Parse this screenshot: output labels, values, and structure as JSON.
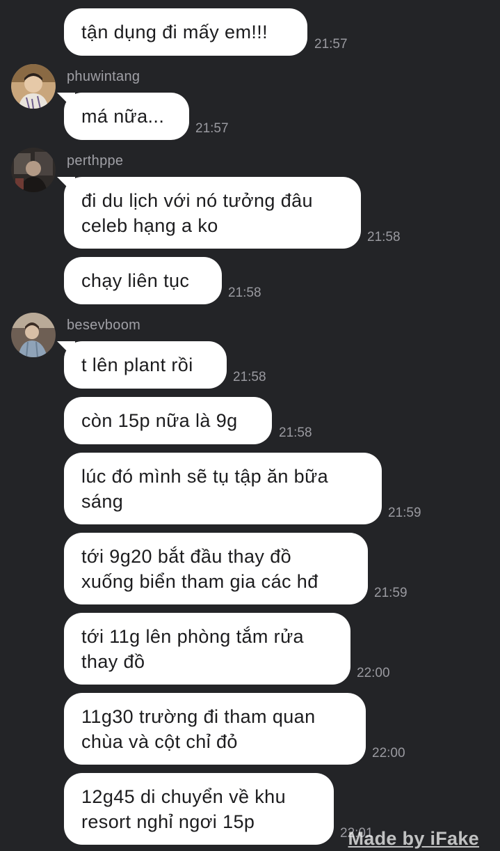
{
  "chat": {
    "messages": [
      {
        "text": "tận dụng đi mấy em!!!",
        "time": "21:57"
      },
      {
        "sender": "phuwintang",
        "text": "má nữa...",
        "time": "21:57"
      },
      {
        "sender": "perthppe",
        "text": "đi du lịch với nó tưởng đâu\nceleb hạng a ko",
        "time": "21:58"
      },
      {
        "text": "chạy liên tục",
        "time": "21:58"
      },
      {
        "sender": "besevboom",
        "text": "t lên plant rồi",
        "time": "21:58"
      },
      {
        "text": "còn 15p nữa là 9g",
        "time": "21:58"
      },
      {
        "text": "lúc đó mình sẽ tụ tập ăn bữa\nsáng",
        "time": "21:59"
      },
      {
        "text": "tới 9g20 bắt đầu thay đồ\nxuống biển tham gia các hđ",
        "time": "21:59"
      },
      {
        "text": "tới 11g lên phòng tắm rửa\nthay đồ",
        "time": "22:00"
      },
      {
        "text": "11g30 trường đi tham quan\nchùa và cột chỉ đỏ",
        "time": "22:00"
      },
      {
        "text": "12g45 di chuyển về khu\nresort nghỉ ngơi 15p",
        "time": "22:01"
      }
    ]
  },
  "watermark": "Made by iFake",
  "colors": {
    "background": "#232427",
    "bubble": "#ffffff",
    "bubble_text": "#1c1c1e",
    "timestamp": "#9a9aa0",
    "sender": "#a0a0a6"
  }
}
